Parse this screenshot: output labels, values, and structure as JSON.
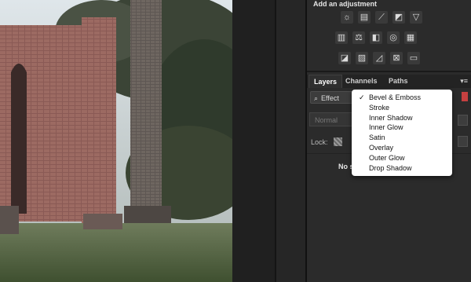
{
  "adjustments": {
    "title": "Add an adjustment",
    "rows": [
      [
        "brightness-icon",
        "levels-icon",
        "curves-icon",
        "exposure-icon",
        "vibrance-icon"
      ],
      [
        "hue-saturation-icon",
        "color-balance-icon",
        "black-white-icon",
        "photo-filter-icon",
        "channel-mixer-icon"
      ],
      [
        "invert-icon",
        "posterize-icon",
        "threshold-icon",
        "selective-color-icon",
        "gradient-map-icon"
      ]
    ],
    "glyphs": {
      "brightness-icon": "☼",
      "levels-icon": "▤",
      "curves-icon": "⟋",
      "exposure-icon": "◩",
      "vibrance-icon": "▽",
      "hue-saturation-icon": "▥",
      "color-balance-icon": "⚖",
      "black-white-icon": "◧",
      "photo-filter-icon": "◎",
      "channel-mixer-icon": "▦",
      "invert-icon": "◪",
      "posterize-icon": "▨",
      "threshold-icon": "◿",
      "selective-color-icon": "⊠",
      "gradient-map-icon": "▭"
    }
  },
  "tabs": [
    {
      "label": "Layers",
      "active": true
    },
    {
      "label": "Channels",
      "active": false
    },
    {
      "label": "Paths",
      "active": false
    }
  ],
  "tab_menu": "▾≡",
  "filter": {
    "label": "Effect",
    "icon": "⌕"
  },
  "blend_mode": "Normal",
  "lock_label": "Lock:",
  "empty_text": "No s",
  "effects_dropdown": {
    "items": [
      {
        "label": "Bevel & Emboss",
        "checked": true
      },
      {
        "label": "Stroke",
        "checked": false
      },
      {
        "label": "Inner Shadow",
        "checked": false
      },
      {
        "label": "Inner Glow",
        "checked": false
      },
      {
        "label": "Satin",
        "checked": false
      },
      {
        "label": "Overlay",
        "checked": false
      },
      {
        "label": "Outer Glow",
        "checked": false
      },
      {
        "label": "Drop Shadow",
        "checked": false
      }
    ],
    "check_glyph": "✓"
  },
  "colors": {
    "panel_bg": "#2b2b2b",
    "dropdown_bg": "#ffffff",
    "accent_red": "#c54040"
  }
}
